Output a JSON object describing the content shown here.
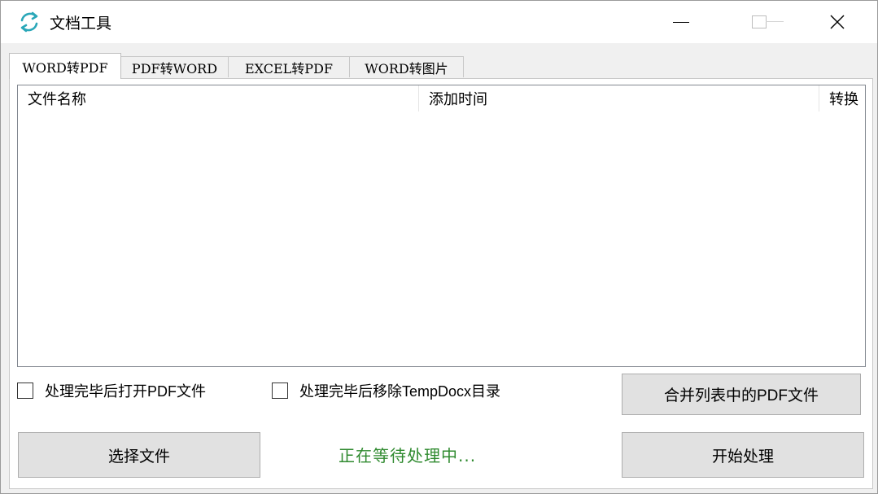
{
  "window": {
    "title": "文档工具",
    "app_icon": "refresh-icon",
    "controls": {
      "minimize": "minimize-icon",
      "maximize": "maximize-icon",
      "close": "close-icon"
    }
  },
  "tabs": [
    {
      "label": "WORD转PDF",
      "active": true
    },
    {
      "label": "PDF转WORD",
      "active": false
    },
    {
      "label": "EXCEL转PDF",
      "active": false
    },
    {
      "label": "WORD转图片",
      "active": false
    }
  ],
  "file_list": {
    "columns": [
      "文件名称",
      "添加时间",
      "转换"
    ],
    "rows": []
  },
  "options": {
    "open_pdf_after": {
      "label": "处理完毕后打开PDF文件",
      "checked": false
    },
    "remove_temp_dir": {
      "label": "处理完毕后移除TempDocx目录",
      "checked": false
    }
  },
  "buttons": {
    "merge": "合并列表中的PDF文件",
    "select_files": "选择文件",
    "start": "开始处理"
  },
  "status": {
    "text": "正在等待处理中...",
    "color": "#2f8a2f"
  },
  "colors": {
    "accent": "#2aa7b8",
    "titlebar": "#ffffff",
    "background": "#f0f0f0"
  }
}
